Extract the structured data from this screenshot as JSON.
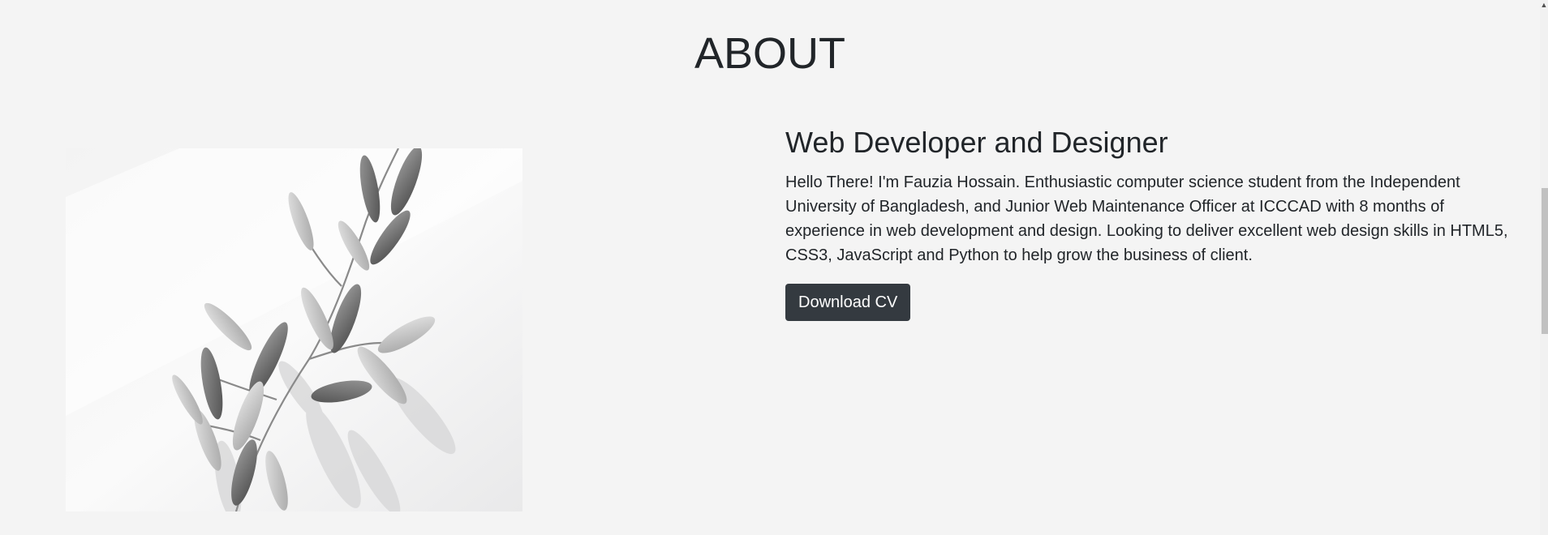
{
  "section": {
    "title": "ABOUT"
  },
  "about": {
    "role": "Web Developer and Designer",
    "bio": "Hello There! I'm Fauzia Hossain. Enthusiastic computer science student from the Independent University of Bangladesh, and Junior Web Maintenance Officer at ICCCAD with 8 months of experience in web development and design. Looking to deliver excellent web design skills in HTML5, CSS3, JavaScript and Python to help grow the business of client.",
    "download_label": "Download CV",
    "image_icon": "leaves-photo"
  },
  "scrollbar": {
    "up_arrow": "▲"
  },
  "colors": {
    "background": "#f4f4f4",
    "button": "#343a40",
    "text": "#212529"
  }
}
